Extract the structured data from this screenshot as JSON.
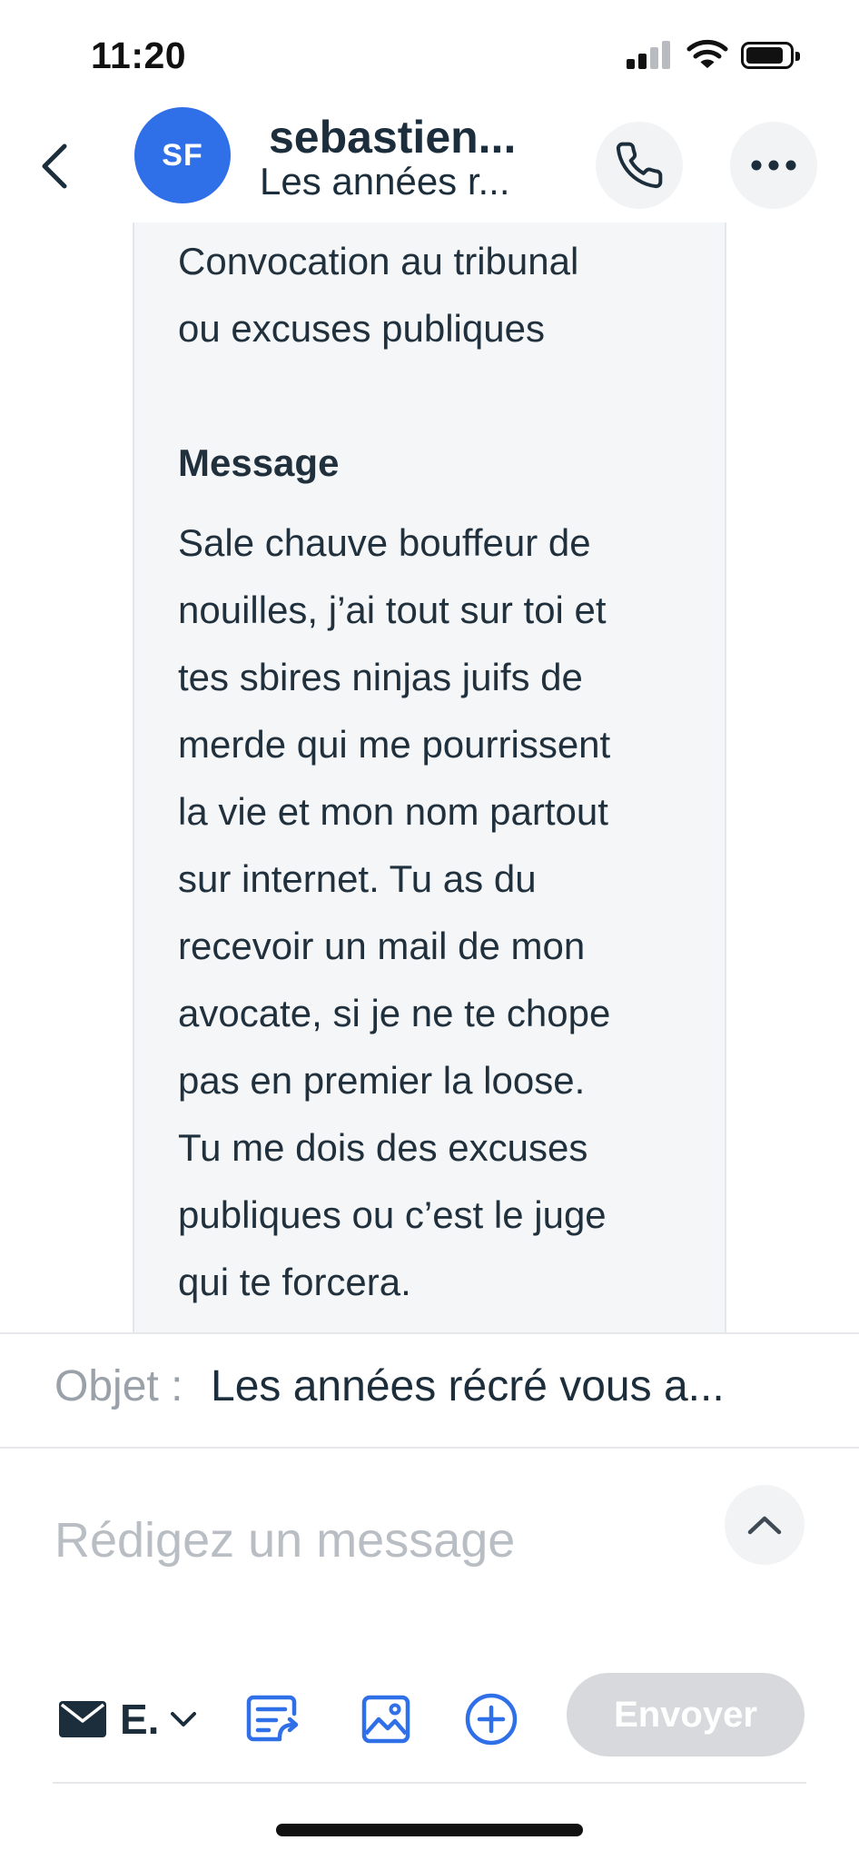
{
  "status_bar": {
    "time": "11:20",
    "icons": [
      "signal-icon",
      "wifi-icon",
      "battery-icon"
    ]
  },
  "header": {
    "back_icon": "chevron-left-icon",
    "avatar_initials": "SF",
    "contact_name": "sebastien...",
    "contact_subtitle": "Les années r...",
    "call_icon": "phone-icon",
    "more_icon": "more-horizontal-icon",
    "avatar_color": "#2f6fe8"
  },
  "message": {
    "subject_lines": [
      "Convocation au tribunal",
      "ou excuses publiques"
    ],
    "heading": "Message",
    "body_lines": [
      "Sale chauve bouffeur de",
      "nouilles, j’ai tout sur toi et",
      "tes sbires ninjas juifs de",
      "merde qui me pourrissent",
      "la vie et mon nom partout",
      "sur internet. Tu as du",
      "recevoir un mail de mon",
      "avocate, si je ne te chope",
      "pas en premier la loose.",
      "Tu me dois des excuses",
      "publiques ou c’est le juge",
      "qui te forcera."
    ]
  },
  "subject_bar": {
    "label": "Objet :",
    "value": "Les années récré vous a..."
  },
  "compose": {
    "placeholder": "Rédigez un message",
    "collapse_icon": "chevron-up-icon"
  },
  "toolbar": {
    "channel_icon": "mail-icon",
    "channel_label": "E.",
    "channel_dropdown_icon": "chevron-down-icon",
    "tools": [
      "template-icon",
      "image-icon",
      "add-circle-icon"
    ],
    "send_label": "Envoyer",
    "accent_color": "#2f6fe8"
  }
}
